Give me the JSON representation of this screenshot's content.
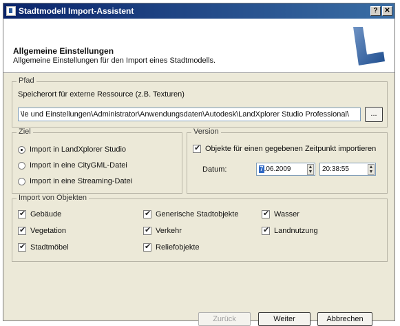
{
  "window": {
    "title": "Stadtmodell Import-Assistent",
    "help_button": "?",
    "close_button": "✕"
  },
  "header": {
    "title": "Allgemeine Einstellungen",
    "subtitle": "Allgemeine Einstellungen für den Import eines Stadtmodells."
  },
  "pfad": {
    "legend": "Pfad",
    "label": "Speicherort für externe Ressource (z.B. Texturen)",
    "path_value": "\\le und Einstellungen\\Administrator\\Anwendungsdaten\\Autodesk\\LandXplorer Studio Professional\\",
    "browse_label": "..."
  },
  "ziel": {
    "legend": "Ziel",
    "options": [
      {
        "label": "Import in LandXplorer Studio",
        "checked": true
      },
      {
        "label": "Import in eine CityGML-Datei",
        "checked": false
      },
      {
        "label": "Import in eine Streaming-Datei",
        "checked": false
      }
    ]
  },
  "version": {
    "legend": "Version",
    "checkbox_label": "Objekte für einen gegebenen Zeitpunkt importieren",
    "checkbox_checked": true,
    "datum_label": "Datum:",
    "date_day": "7",
    "date_rest": ".06.2009",
    "time_value": "20:38:55"
  },
  "objekte": {
    "legend": "Import von Objekten",
    "items": [
      {
        "label": "Gebäude",
        "checked": true
      },
      {
        "label": "Generische Stadtobjekte",
        "checked": true
      },
      {
        "label": "Wasser",
        "checked": true
      },
      {
        "label": "Vegetation",
        "checked": true
      },
      {
        "label": "Verkehr",
        "checked": true
      },
      {
        "label": "Landnutzung",
        "checked": true
      },
      {
        "label": "Stadtmöbel",
        "checked": true
      },
      {
        "label": "Reliefobjekte",
        "checked": true
      }
    ]
  },
  "footer": {
    "back_label": "Zurück",
    "next_label": "Weiter",
    "cancel_label": "Abbrechen"
  }
}
